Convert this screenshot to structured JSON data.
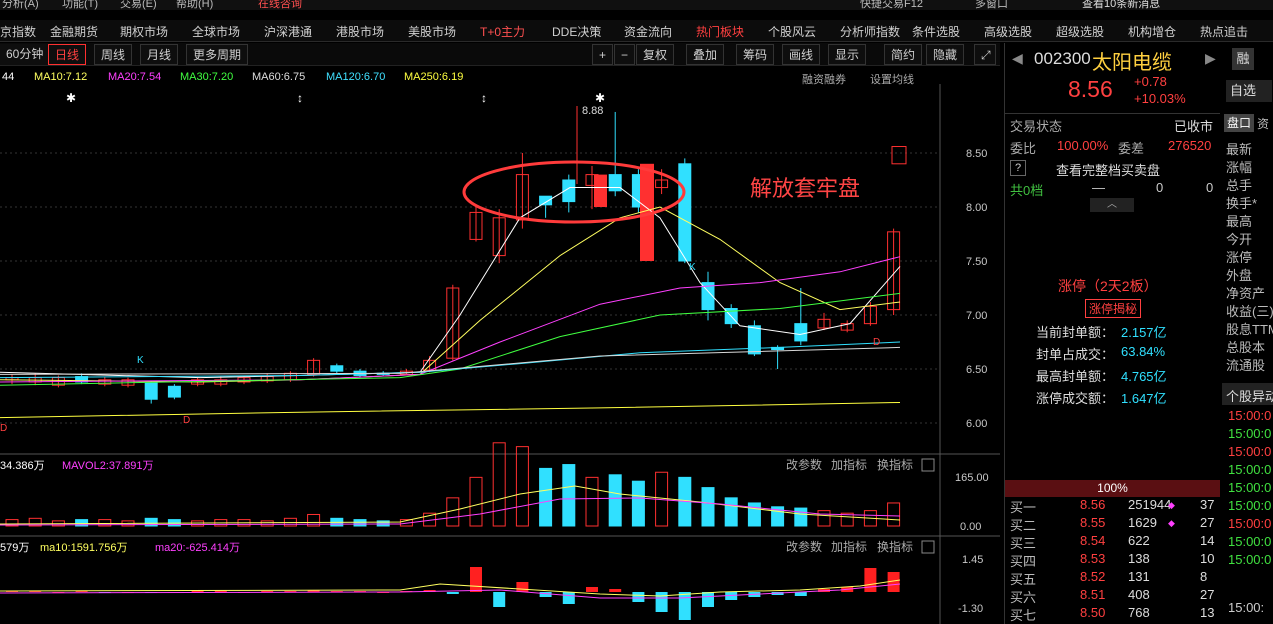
{
  "topbar": {
    "items": [
      "分析(A)",
      "功能(T)",
      "交易(E)",
      "帮助(H)",
      "在线咨询",
      "快捷交易F12",
      "多窗口",
      "查看10条新消息"
    ]
  },
  "nav": {
    "items": [
      "京指数",
      "金融期货",
      "期权市场",
      "全球市场",
      "沪深港通",
      "港股市场",
      "美股市场",
      "T+0主力",
      "DDE决策",
      "资金流向",
      "热门板块",
      "个股风云",
      "分析师指数",
      "条件选股",
      "高级选股",
      "超级选股",
      "机构增仓",
      "热点追击"
    ]
  },
  "period": {
    "items": [
      "60分钟",
      "日线",
      "周线",
      "月线",
      "更多周期"
    ],
    "active": "日线"
  },
  "tools": {
    "plus": "+",
    "minus": "−",
    "restore": "复权",
    "overlay": "叠加",
    "chips": "筹码",
    "draw": "画线",
    "display": "显示",
    "simple": "简约",
    "hide": "隐藏"
  },
  "ma": {
    "ma5": "44",
    "ma10": "MA10:7.12",
    "ma20": "MA20:7.54",
    "ma30": "MA30:7.20",
    "ma60": "MA60:6.75",
    "ma120": "MA120:6.70",
    "ma250": "MA250:6.19",
    "margin": "融资融券",
    "setma": "设置均线"
  },
  "annotation": "解放套牢盘",
  "peak_label": "8.88",
  "markers": {
    "k": "K",
    "d": "D"
  },
  "price_axis": [
    "8.50",
    "8.00",
    "7.50",
    "7.00",
    "6.50",
    "6.00"
  ],
  "vol": {
    "label": "34.386万",
    "mavol2": "MAVOL2:37.891万",
    "axis_top": "165.00",
    "axis_bottom": "0.00",
    "tools": [
      "改参数",
      "加指标",
      "换指标"
    ]
  },
  "ind": {
    "label": "579万",
    "ma10": "ma10:1591.756万",
    "ma20": "ma20:-625.414万",
    "axis_top": "1.45",
    "axis_bottom": "-1.30",
    "tools": [
      "改参数",
      "加指标",
      "换指标"
    ]
  },
  "stock": {
    "code": "002300",
    "name": "太阳电缆",
    "price": "8.56",
    "change": "+0.78",
    "pct": "+10.03%",
    "rong": "融",
    "zixuan": "自选"
  },
  "status": {
    "label": "交易状态",
    "value": "已收市",
    "weibi_label": "委比",
    "weibi": "100.00%",
    "weicha_label": "委差",
    "weicha": "276520",
    "full_queue": "查看完整档买卖盘",
    "q": "?",
    "total_label": "共0档",
    "total_dash": "—",
    "total_a": "0",
    "total_b": "0"
  },
  "limit": {
    "title": "涨停（2天2板）",
    "btn": "涨停揭秘",
    "rows": [
      {
        "k": "当前封单额：",
        "v": "2.157亿"
      },
      {
        "k": "封单占成交：",
        "v": "63.84%"
      },
      {
        "k": "最高封单额：",
        "v": "4.765亿"
      },
      {
        "k": "涨停成交额：",
        "v": "1.647亿"
      }
    ]
  },
  "book": {
    "pct": "100%",
    "rows": [
      {
        "n": "买一",
        "p": "8.56",
        "v": "251944",
        "c": "37"
      },
      {
        "n": "买二",
        "p": "8.55",
        "v": "1629",
        "c": "27"
      },
      {
        "n": "买三",
        "p": "8.54",
        "v": "622",
        "c": "14"
      },
      {
        "n": "买四",
        "p": "8.53",
        "v": "138",
        "c": "10"
      },
      {
        "n": "买五",
        "p": "8.52",
        "v": "131",
        "c": "8"
      },
      {
        "n": "买六",
        "p": "8.51",
        "v": "408",
        "c": "27"
      },
      {
        "n": "买七",
        "p": "8.50",
        "v": "768",
        "c": "13"
      }
    ]
  },
  "side": {
    "tab1": "盘口",
    "tab2": "资",
    "labels": [
      "最新",
      "涨幅",
      "总手",
      "换手*",
      "最高",
      "今开",
      "涨停",
      "外盘",
      "净资产",
      "收益(三)",
      "股息TTM",
      "总股本",
      "流通股"
    ],
    "section": "个股异动",
    "times": [
      "15:00:0",
      "15:00:0",
      "15:00:0",
      "15:00:0",
      "15:00:0",
      "15:00:0",
      "15:00:0",
      "15:00:0",
      "15:00:0"
    ],
    "time_bottom": "15:00:"
  }
}
